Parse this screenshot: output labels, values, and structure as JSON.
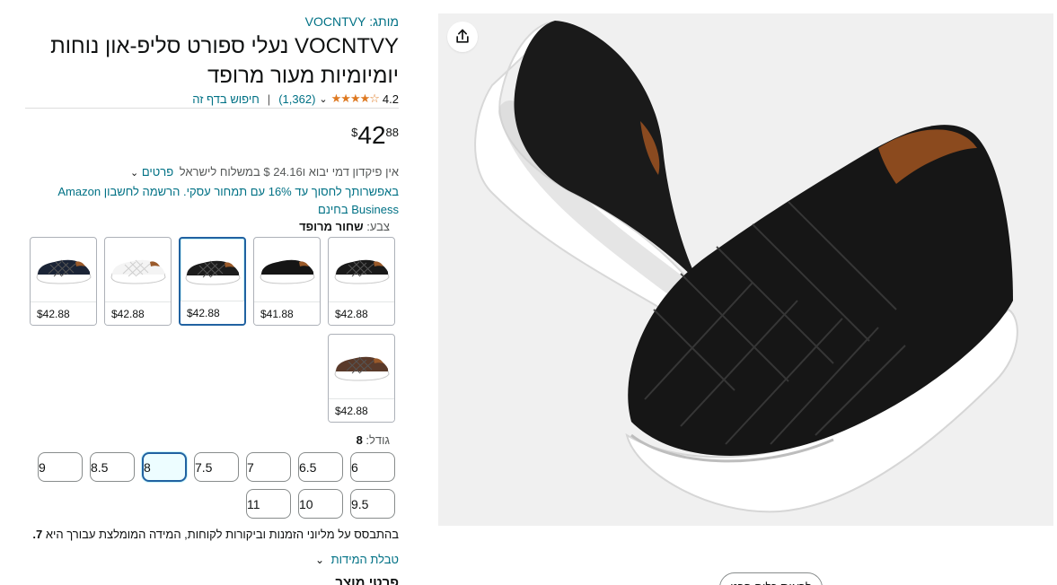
{
  "product": {
    "brand_prefix": "מותג:",
    "brand": "VOCNTVY",
    "title": "VOCNTVY נעלי ספורט סליפ-און נוחות יומיומיות מעור מרופד",
    "rating": "4.2",
    "stars_text": "★★★★☆",
    "rating_count": "(1,362)",
    "search_link": "חיפוש בדף זה",
    "price": {
      "symbol": "$",
      "whole": "42",
      "fraction": "88"
    },
    "shipping_text": "אין פיקדון דמי יבוא ו24.16 $ במשלוח לישראל",
    "shipping_details_link": "פרטים",
    "promo_text": "באפשרותך לחסוך עד 16% עם תמחור עסקי. הרשמה לחשבון Amazon Business בחינם"
  },
  "color": {
    "label": "צבע:",
    "selected": "שחור מרופד",
    "swatches": [
      {
        "price": "$42.88",
        "shoe_color": "#1a1a1a",
        "sole_color": "#ffffff",
        "pattern": "quilted",
        "selected": false
      },
      {
        "price": "$41.88",
        "shoe_color": "#151515",
        "sole_color": "#ffffff",
        "pattern": "plain",
        "selected": false
      },
      {
        "price": "$42.88",
        "shoe_color": "#1c1c1c",
        "sole_color": "#ffffff",
        "pattern": "quilted",
        "selected": true
      },
      {
        "price": "$42.88",
        "shoe_color": "#f4f4f4",
        "sole_color": "#ffffff",
        "pattern": "quilted",
        "selected": false
      },
      {
        "price": "$42.88",
        "shoe_color": "#1b2436",
        "sole_color": "#ffffff",
        "pattern": "quilted",
        "selected": false
      },
      {
        "price": "$42.88",
        "shoe_color": "#5a3a2a",
        "sole_color": "#ffffff",
        "pattern": "quilted",
        "selected": false
      }
    ]
  },
  "size": {
    "label": "גודל:",
    "selected": "8",
    "options": [
      "6",
      "6.5",
      "7",
      "7.5",
      "8",
      "8.5",
      "9",
      "9.5",
      "10",
      "11"
    ]
  },
  "fit_note": {
    "text": "בהתבסס על מליוני הזמנות וביקורות לקוחות, המידה המומלצת עבורך היא",
    "size": "7."
  },
  "size_chart_link": "טבלת המידות",
  "details_heading": "פרטי מוצר",
  "image_panel": {
    "see_all_button": "לראות כלום פרט"
  },
  "colors": {
    "link": "#007185",
    "star": "#de7921",
    "selected_border": "#2162a1"
  }
}
